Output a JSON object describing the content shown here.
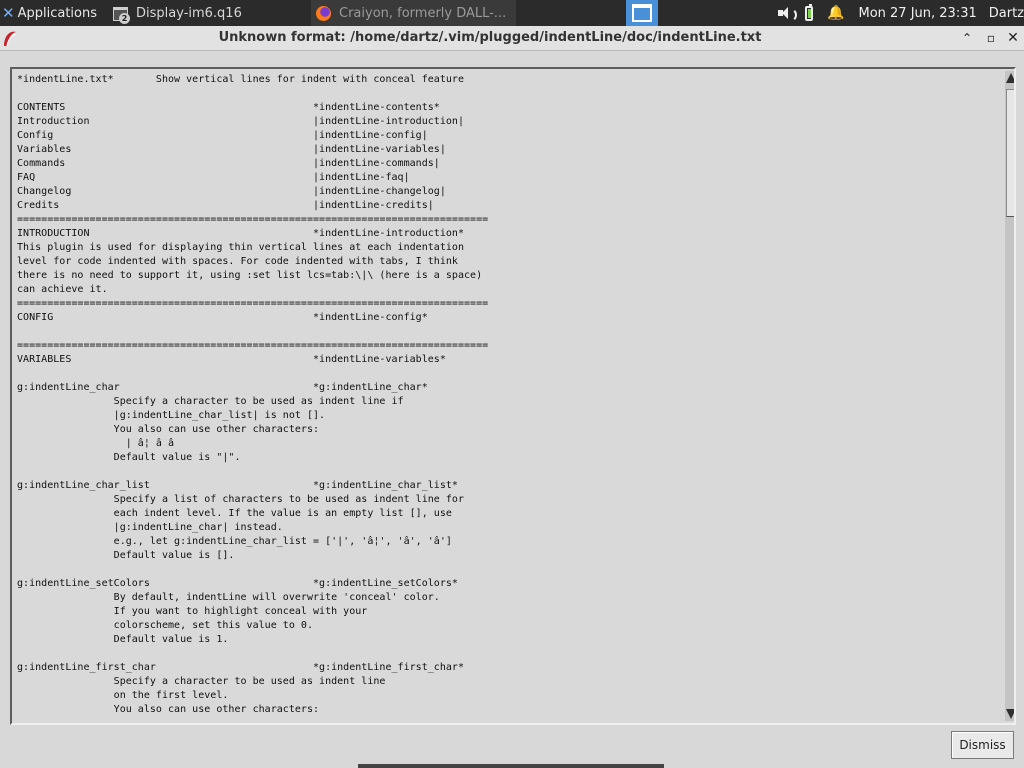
{
  "panel": {
    "applications_label": "Applications",
    "task1_label": "Display-im6.q16",
    "task1_badge": "2",
    "task2_label": "Craiyon, formerly DALL-...",
    "clock": "Mon 27 Jun, 23:31",
    "user": "Dartz",
    "bell_glyph": "🔔"
  },
  "window": {
    "title": "Unknown format: /home/dartz/.vim/plugged/indentLine/doc/indentLine.txt",
    "minimize_glyph": "⌃",
    "maximize_glyph": "▫",
    "close_glyph": "✕"
  },
  "document": {
    "lines": [
      "*indentLine.txt*       Show vertical lines for indent with conceal feature",
      "",
      "CONTENTS                                         *indentLine-contents*",
      "Introduction                                     |indentLine-introduction|",
      "Config                                           |indentLine-config|",
      "Variables                                        |indentLine-variables|",
      "Commands                                         |indentLine-commands|",
      "FAQ                                              |indentLine-faq|",
      "Changelog                                        |indentLine-changelog|",
      "Credits                                          |indentLine-credits|",
      "==============================================================================",
      "INTRODUCTION                                     *indentLine-introduction*",
      "This plugin is used for displaying thin vertical lines at each indentation",
      "level for code indented with spaces. For code indented with tabs, I think",
      "there is no need to support it, using :set list lcs=tab:\\|\\ (here is a space)",
      "can achieve it.",
      "==============================================================================",
      "CONFIG                                           *indentLine-config*",
      "",
      "==============================================================================",
      "VARIABLES                                        *indentLine-variables*",
      "",
      "g:indentLine_char                                *g:indentLine_char*",
      "                Specify a character to be used as indent line if",
      "                |g:indentLine_char_list| is not [].",
      "                You also can use other characters:",
      "                  | â¦ â â",
      "                Default value is \"|\".",
      "",
      "g:indentLine_char_list                           *g:indentLine_char_list*",
      "                Specify a list of characters to be used as indent line for",
      "                each indent level. If the value is an empty list [], use",
      "                |g:indentLine_char| instead.",
      "                e.g., let g:indentLine_char_list = ['|', 'â¦', 'â', 'â']",
      "                Default value is [].",
      "",
      "g:indentLine_setColors                           *g:indentLine_setColors*",
      "                By default, indentLine will overwrite 'conceal' color.",
      "                If you want to highlight conceal with your",
      "                colorscheme, set this value to 0.",
      "                Default value is 1.",
      "",
      "g:indentLine_first_char                          *g:indentLine_first_char*",
      "                Specify a character to be used as indent line",
      "                on the first level.",
      "                You also can use other characters:"
    ]
  },
  "dismiss_label": "Dismiss"
}
